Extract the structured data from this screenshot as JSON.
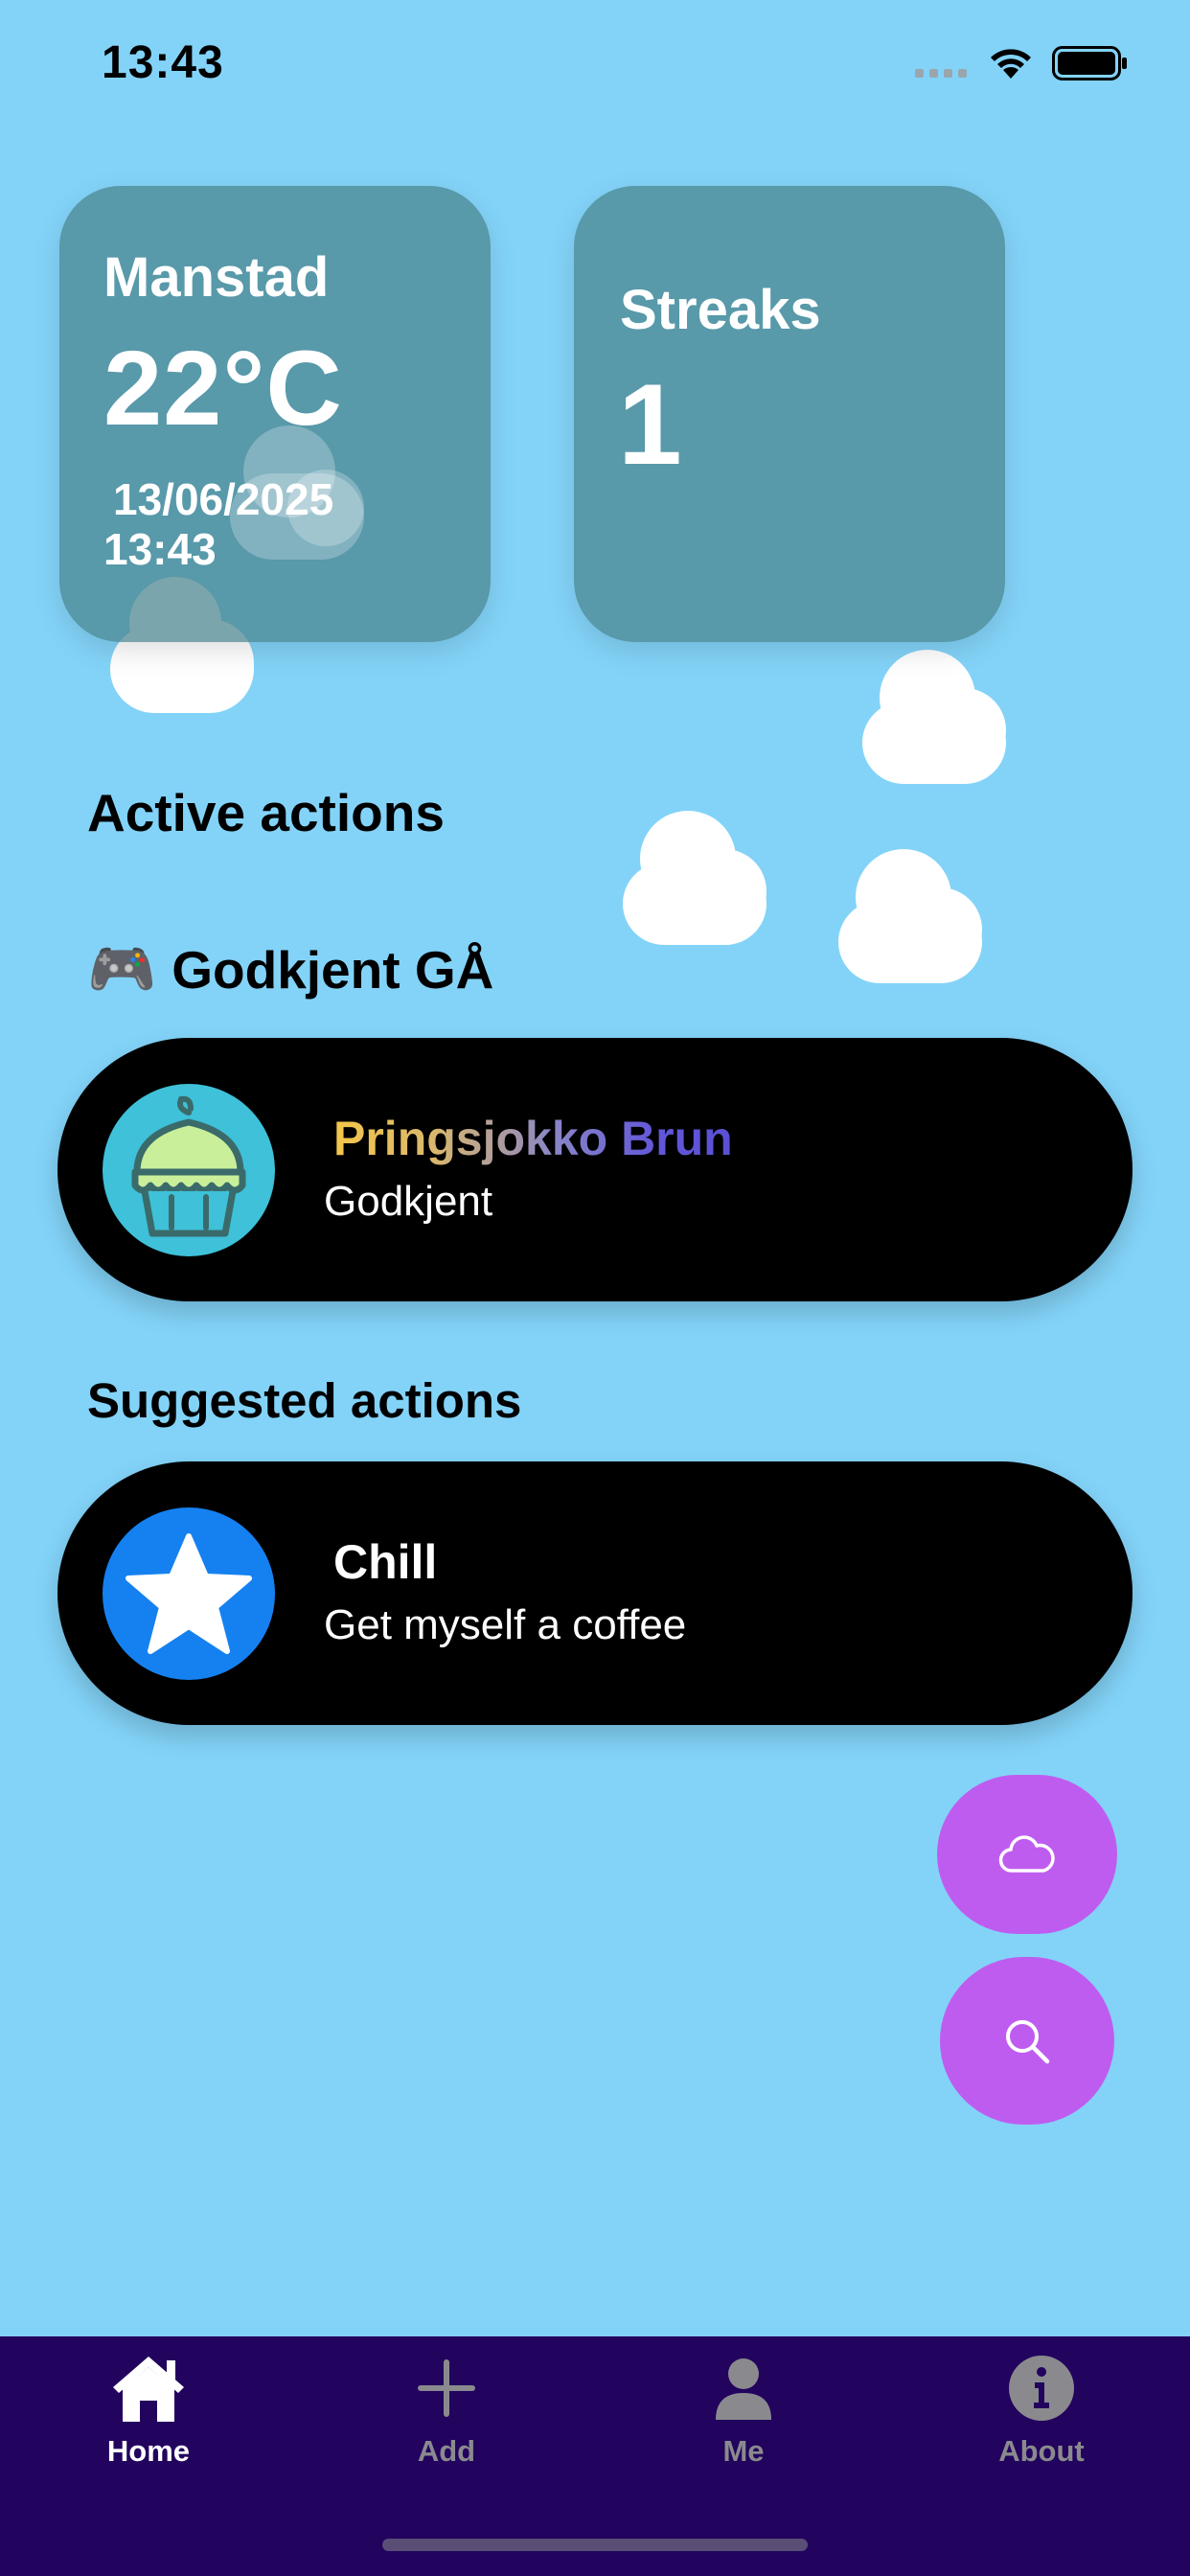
{
  "status_bar": {
    "time": "13:43"
  },
  "weather_card": {
    "location": "Manstad",
    "temperature": "22°C",
    "date": "13/06/2025",
    "time": "13:43"
  },
  "streak_card": {
    "title": "Streaks",
    "count": "1"
  },
  "active": {
    "heading": "Active actions",
    "group_emoji": "🎮",
    "group_title": "Godkjent GÅ",
    "item": {
      "title": "Pringsjokko Brun",
      "subtitle": "Godkjent",
      "icon": "cupcake-icon"
    }
  },
  "suggested": {
    "heading": "Suggested actions",
    "item": {
      "title": "Chill",
      "subtitle": "Get myself a coffee",
      "icon": "star-icon"
    }
  },
  "fabs": {
    "weather_icon": "cloud-icon",
    "search_icon": "search-icon"
  },
  "tabs": [
    {
      "label": "Home",
      "icon": "home-icon",
      "active": true
    },
    {
      "label": "Add",
      "icon": "plus-icon",
      "active": false
    },
    {
      "label": "Me",
      "icon": "person-icon",
      "active": false
    },
    {
      "label": "About",
      "icon": "info-icon",
      "active": false
    }
  ],
  "colors": {
    "background": "#83d3f8",
    "card": "#5e9ba6",
    "pill": "#000000",
    "fab": "#bf5cf0",
    "tabbar": "#22035e",
    "active_icon": "#3ec1d9",
    "star_bg": "#1581f0"
  }
}
